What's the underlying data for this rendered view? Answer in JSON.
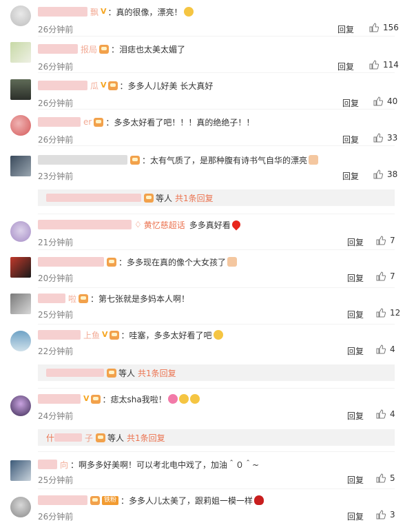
{
  "comments": [
    {
      "name_suffix": "飘",
      "vip": true,
      "text": "真的很像，漂亮！",
      "time": "26分钟前",
      "reply": "回复",
      "likes": "156"
    },
    {
      "name_suffix": "报局",
      "vip": false,
      "text": "泪痣也太美太媚了",
      "time": "26分钟前",
      "reply": "回复",
      "likes": "114"
    },
    {
      "name_suffix": "瓜",
      "vip": true,
      "text": "多多人儿好美 长大真好",
      "time": "26分钟前",
      "reply": "回复",
      "likes": "40"
    },
    {
      "name_suffix": "er",
      "vip": false,
      "text": "多多太好看了吧！！！真的绝绝子！！",
      "time": "26分钟前",
      "reply": "回复",
      "likes": "33"
    },
    {
      "name_suffix": "",
      "vip": false,
      "text": "太有气质了，是那种腹有诗书气自华的漂亮",
      "time": "23分钟前",
      "reply": "回复",
      "likes": "38"
    },
    {
      "name_suffix": "",
      "vip": false,
      "chaohua": "黄忆慈超话",
      "text": "多多真好看",
      "time": "21分钟前",
      "reply": "回复",
      "likes": "7"
    },
    {
      "name_suffix": "",
      "vip": false,
      "text": "多多现在真的像个大女孩了",
      "time": "20分钟前",
      "reply": "回复",
      "likes": "7"
    },
    {
      "name_suffix": "啦",
      "vip": false,
      "text": "第七张就是多妈本人啊！",
      "time": "25分钟前",
      "reply": "回复",
      "likes": "12"
    },
    {
      "name_suffix": "上鱼",
      "vip": true,
      "text": "哇塞，多多太好看了吧",
      "time": "22分钟前",
      "reply": "回复",
      "likes": "4"
    },
    {
      "name_suffix": "",
      "vip": true,
      "text": "痣太sha我啦！",
      "time": "24分钟前",
      "reply": "回复",
      "likes": "4"
    },
    {
      "name_suffix": "向",
      "vip": false,
      "text": "啊多多好美啊！可以考北电中戏了，加油＾０＾~",
      "time": "25分钟前",
      "reply": "回复",
      "likes": "5"
    },
    {
      "name_suffix": "",
      "vip": false,
      "fan": "铁粉",
      "text": "多多人儿太美了，跟莉姐一模一样",
      "time": "26分钟前",
      "reply": "回复",
      "likes": "3"
    }
  ],
  "replies_summary": [
    {
      "prefix": "",
      "suffix": "等人",
      "link": "共1条回复"
    },
    {
      "prefix": "",
      "suffix": "等人",
      "link": "共1条回复"
    },
    {
      "prefix": "什",
      "mid": "子",
      "suffix": "等人",
      "link": "共1条回复"
    }
  ],
  "colon": "：",
  "colors": {
    "link": "#eb7350",
    "vip": "#f5a623",
    "time": "#808080",
    "bg_more": "#f2f2f2"
  }
}
